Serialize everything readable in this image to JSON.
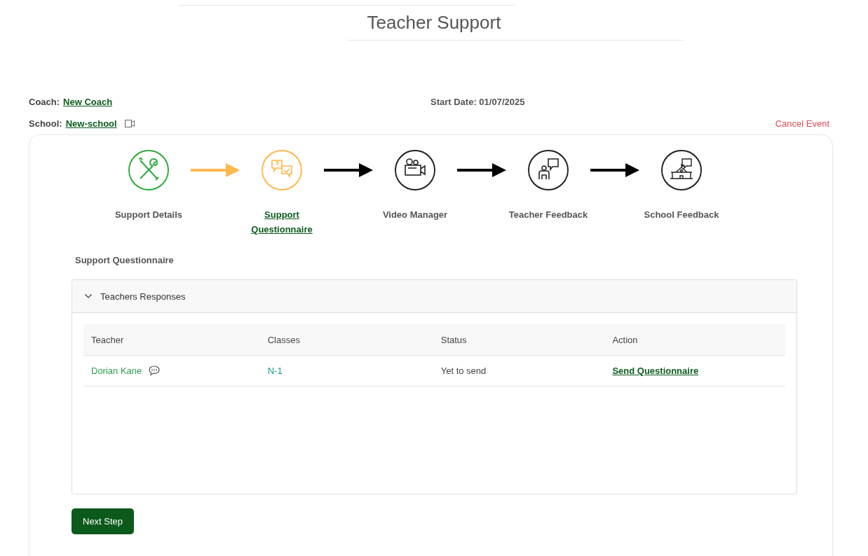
{
  "title": "Teacher Support",
  "coach": {
    "label": "Coach:",
    "value": "New Coach"
  },
  "start_date": "Start Date: 01/07/2025",
  "school": {
    "label": "School:",
    "value": "New-school"
  },
  "cancel": "Cancel Event",
  "steps": [
    {
      "kind": "tools",
      "label": "Support Details",
      "completed": true,
      "selected": false
    },
    {
      "kind": "questions",
      "label": "Support Questionnaire",
      "completed": false,
      "selected": true
    },
    {
      "kind": "video",
      "label": "Video Manager",
      "completed": false,
      "selected": false
    },
    {
      "kind": "teacher",
      "label": "Teacher Feedback",
      "completed": false,
      "selected": false
    },
    {
      "kind": "school",
      "label": "School Feedback",
      "completed": false,
      "selected": false
    }
  ],
  "section_title": "Support Questionnaire",
  "panel": {
    "title": "Teachers Responses",
    "expanded": true,
    "table": {
      "columns": [
        "Teacher",
        "Classes",
        "Status",
        "Action"
      ],
      "rows": [
        {
          "teacher": "Dorian Kane",
          "classes": "N-1",
          "status": "Yet to send",
          "action": "Send Questionnaire"
        }
      ]
    }
  },
  "next_button": "Next Step"
}
